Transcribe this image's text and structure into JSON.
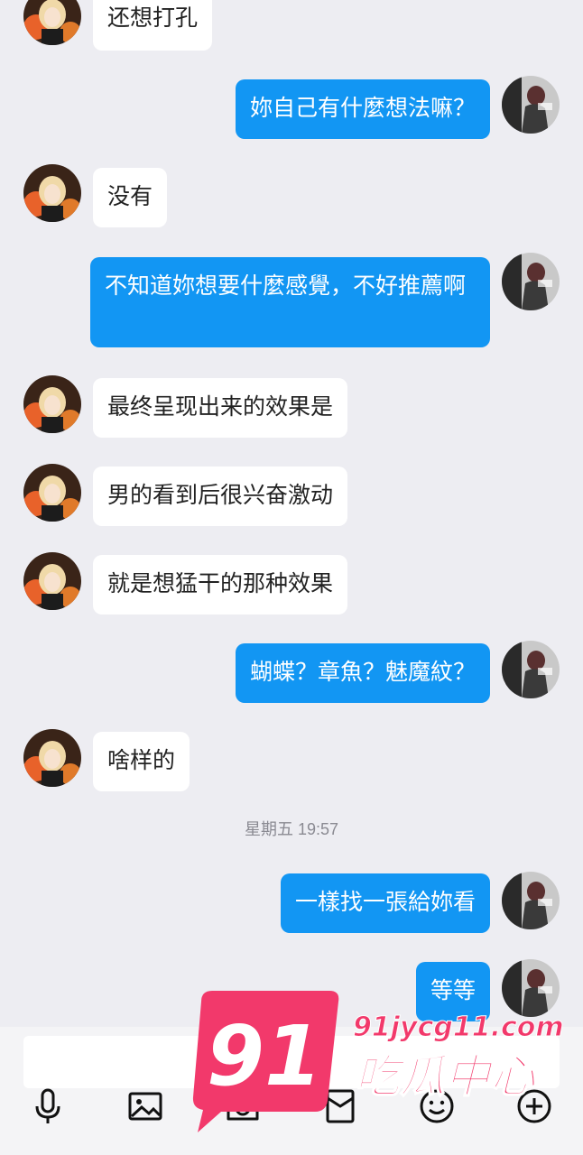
{
  "conversation": {
    "messages": [
      {
        "side": "in",
        "text": "还想打孔"
      },
      {
        "side": "out",
        "text": "妳自己有什麼想法嘛？"
      },
      {
        "side": "in",
        "text": "没有"
      },
      {
        "side": "out",
        "text": "不知道妳想要什麼感覺，不好推薦啊"
      },
      {
        "side": "in",
        "text": "最终呈现出来的效果是"
      },
      {
        "side": "in",
        "text": "男的看到后很兴奋激动"
      },
      {
        "side": "in",
        "text": "就是想猛干的那种效果"
      },
      {
        "side": "out",
        "text": "蝴蝶？章魚？魅魔紋？"
      },
      {
        "side": "in",
        "text": "啥样的"
      },
      {
        "side": "out",
        "text": "一樣找一張給妳看"
      },
      {
        "side": "out",
        "text": "等等"
      }
    ],
    "timestamp": "星期五 19:57"
  },
  "toolbar": {
    "icons": [
      "microphone-icon",
      "image-icon",
      "camera-icon",
      "red-packet-icon",
      "emoji-icon",
      "plus-icon"
    ]
  },
  "watermark": {
    "number": "91",
    "domain": "91jycg11.com",
    "brand": "吃瓜中心"
  },
  "colors": {
    "background": "#ededf2",
    "outgoing_bubble": "#1296f3",
    "incoming_bubble": "#ffffff",
    "watermark_pink": "#f2396b"
  }
}
